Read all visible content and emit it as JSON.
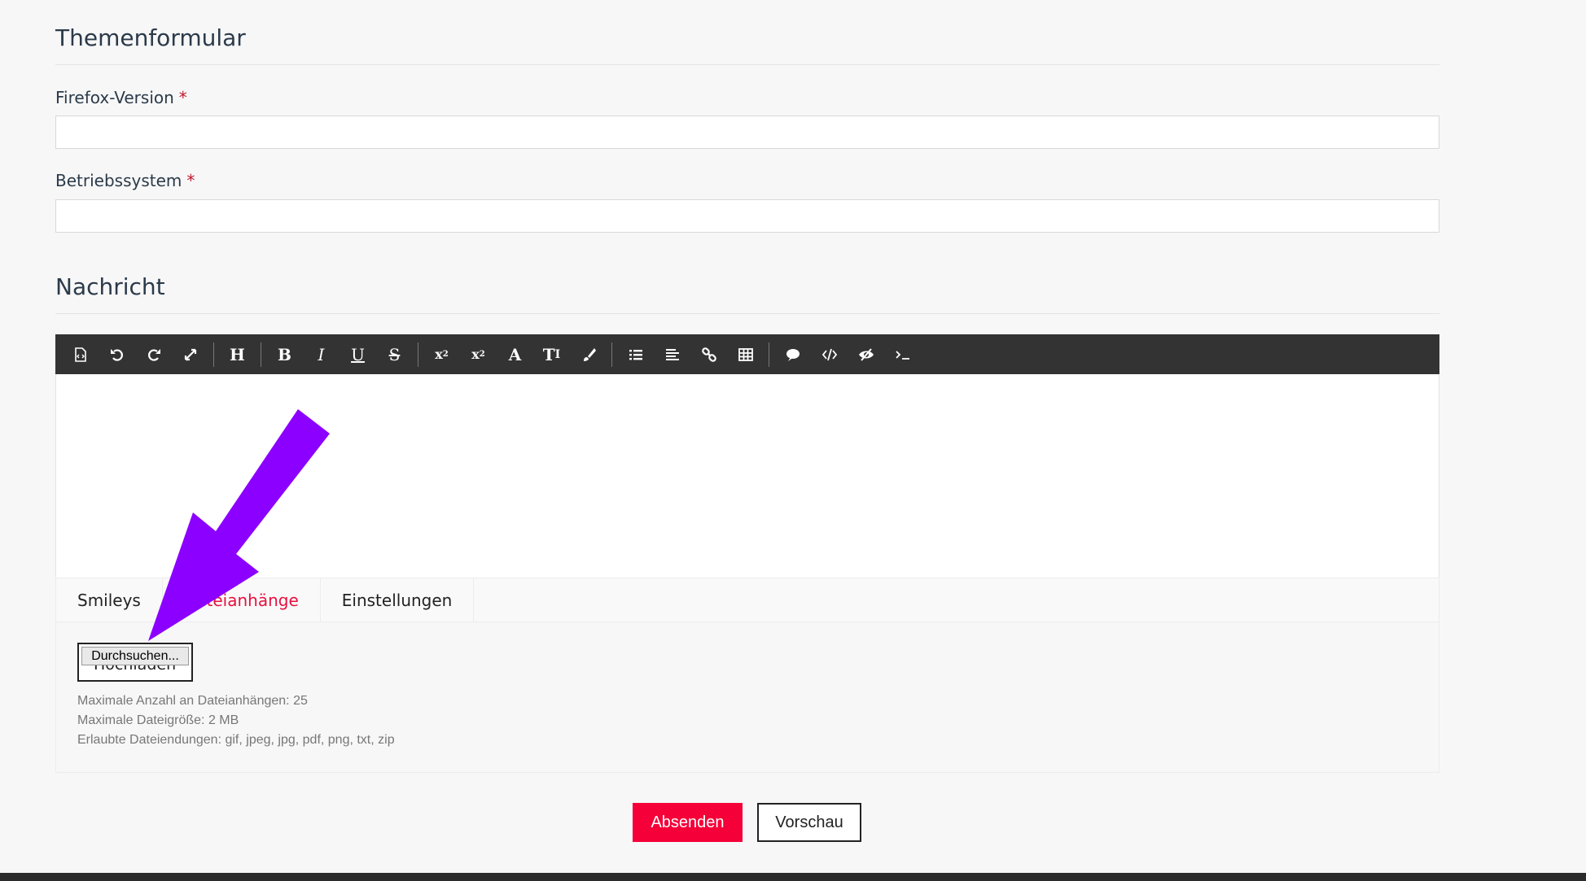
{
  "form": {
    "title": "Themenformular",
    "fields": [
      {
        "label": "Firefox-Version",
        "required_mark": "*",
        "value": ""
      },
      {
        "label": "Betriebssystem",
        "required_mark": "*",
        "value": ""
      }
    ]
  },
  "message": {
    "title": "Nachricht",
    "toolbar": [
      "source-icon",
      "undo-icon",
      "redo-icon",
      "fullscreen-icon",
      "heading-icon",
      "bold-icon",
      "italic-icon",
      "underline-icon",
      "strikethrough-icon",
      "subscript-icon",
      "superscript-icon",
      "font-icon",
      "font-size-icon",
      "color-brush-icon",
      "list-icon",
      "align-icon",
      "link-icon",
      "table-icon",
      "quote-icon",
      "code-icon",
      "spoiler-icon",
      "terminal-icon"
    ],
    "tabs": [
      {
        "label": "Smileys",
        "active": false
      },
      {
        "label": "Dateianhänge",
        "active": true
      },
      {
        "label": "Einstellungen",
        "active": false
      }
    ],
    "attachments": {
      "upload_label": "Hochladen",
      "browse_label": "Durchsuchen...",
      "info": [
        "Maximale Anzahl an Dateianhängen: 25",
        "Maximale Dateigröße: 2 MB",
        "Erlaubte Dateiendungen: gif, jpeg, jpg, pdf, png, txt, zip"
      ]
    }
  },
  "actions": {
    "submit_label": "Absenden",
    "preview_label": "Vorschau"
  },
  "colors": {
    "accent": "#f50038",
    "toolbar_bg": "#333333",
    "annotation_arrow": "#8b00ff"
  }
}
